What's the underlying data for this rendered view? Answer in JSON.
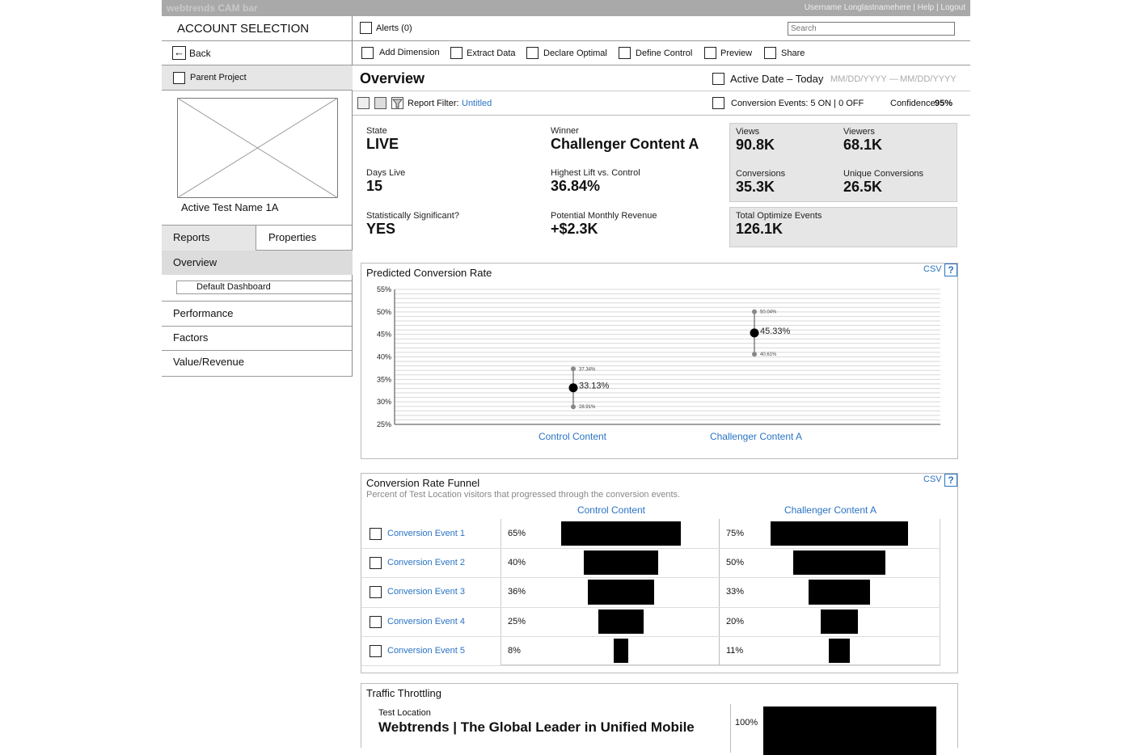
{
  "cam_bar": {
    "brand": "webtrends CAM bar",
    "user_links": "Username Longlastnamehere | Help | Logout"
  },
  "header": {
    "account_selection": "ACCOUNT SELECTION",
    "alerts": "Alerts (0)",
    "search_placeholder": "Search"
  },
  "sidebar": {
    "back": "Back",
    "parent_project": "Parent Project",
    "test_name": "Active Test Name 1A",
    "tabs": [
      "Reports",
      "Properties"
    ],
    "nav": {
      "overview": "Overview",
      "default_dashboard": "Default Dashboard",
      "performance": "Performance",
      "factors": "Factors",
      "value_revenue": "Value/Revenue"
    }
  },
  "toolbar": {
    "items": [
      "Add Dimension",
      "Extract Data",
      "Declare Optimal",
      "Define Control",
      "Preview",
      "Share"
    ]
  },
  "page": {
    "title": "Overview",
    "active_date": "Active Date – Today",
    "date_from": "MM/DD/YYYY",
    "date_sep": "—",
    "date_to": "MM/DD/YYYY",
    "report_filter_label": "Report Filter:",
    "report_filter_value": "Untitled",
    "conversion_events": "Conversion Events: 5 ON | 0 OFF",
    "confidence_label": "Confidence",
    "confidence_value": "95%"
  },
  "stats": {
    "state": {
      "label": "State",
      "value": "LIVE"
    },
    "winner": {
      "label": "Winner",
      "value": "Challenger Content A"
    },
    "days_live": {
      "label": "Days Live",
      "value": "15"
    },
    "highest_lift": {
      "label": "Highest Lift vs. Control",
      "value": "36.84%"
    },
    "stat_sig": {
      "label": "Statistically Significant?",
      "value": "YES"
    },
    "monthly_revenue": {
      "label": "Potential Monthly Revenue",
      "value": "+$2.3K"
    },
    "views": {
      "label": "Views",
      "value": "90.8K"
    },
    "viewers": {
      "label": "Viewers",
      "value": "68.1K"
    },
    "conversions": {
      "label": "Conversions",
      "value": "35.3K"
    },
    "unique_conversions": {
      "label": "Unique Conversions",
      "value": "26.5K"
    },
    "total_optimize": {
      "label": "Total Optimize Events",
      "value": "126.1K"
    }
  },
  "predicted_chart": {
    "title": "Predicted Conversion Rate",
    "csv": "CSV",
    "help": "?"
  },
  "chart_data": {
    "type": "scatter",
    "title": "Predicted Conversion Rate",
    "categories": [
      "Control Content",
      "Challenger Content A"
    ],
    "ylim": [
      25,
      55
    ],
    "yticks": [
      25,
      30,
      35,
      40,
      45,
      50,
      55
    ],
    "ytick_labels": [
      "25%",
      "30%",
      "35%",
      "40%",
      "45%",
      "50%",
      "55%"
    ],
    "points": [
      {
        "category": "Control Content",
        "value": 33.13,
        "value_label": "33.13%",
        "high": 37.34,
        "high_label": "37.34%",
        "low": 28.91,
        "low_label": "28.91%"
      },
      {
        "category": "Challenger Content A",
        "value": 45.33,
        "value_label": "45.33%",
        "high": 50.04,
        "high_label": "50.04%",
        "low": 40.61,
        "low_label": "40.61%"
      }
    ]
  },
  "funnel": {
    "title": "Conversion Rate Funnel",
    "subtitle": "Percent of Test Location visitors that progressed through the conversion events.",
    "csv": "CSV",
    "help": "?",
    "columns": [
      "Control Content",
      "Challenger Content A"
    ],
    "rows": [
      {
        "event": "Conversion Event 1",
        "control": "65%",
        "control_value": 65,
        "challenger": "75%",
        "challenger_value": 75
      },
      {
        "event": "Conversion Event 2",
        "control": "40%",
        "control_value": 40,
        "challenger": "50%",
        "challenger_value": 50
      },
      {
        "event": "Conversion Event 3",
        "control": "36%",
        "control_value": 36,
        "challenger": "33%",
        "challenger_value": 33
      },
      {
        "event": "Conversion Event 4",
        "control": "25%",
        "control_value": 25,
        "challenger": "20%",
        "challenger_value": 20
      },
      {
        "event": "Conversion Event 5",
        "control": "8%",
        "control_value": 8,
        "challenger": "11%",
        "challenger_value": 11
      }
    ]
  },
  "traffic": {
    "title": "Traffic Throttling",
    "test_location_label": "Test Location",
    "test_location_value": "Webtrends | The Global Leader in Unified Mobile",
    "percent": "100%",
    "percent_value": 100
  }
}
